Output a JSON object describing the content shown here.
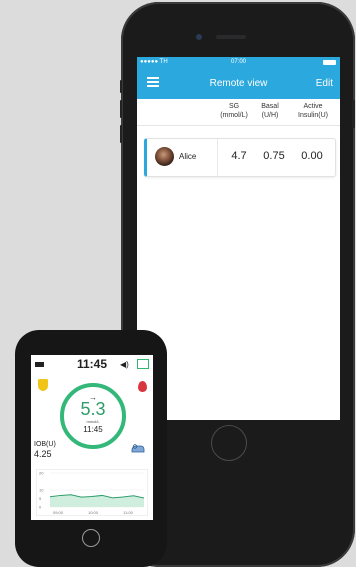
{
  "phone": {
    "status_bar": {
      "carrier": "●●●●● TH",
      "time": "07:00"
    },
    "nav": {
      "title": "Remote view",
      "edit_label": "Edit"
    },
    "columns": {
      "sg": {
        "name": "SG",
        "unit": "(mmol/L)"
      },
      "basal": {
        "name": "Basal",
        "unit": "(U/H)"
      },
      "active": {
        "name": "Active",
        "unit": "Insulin(U)"
      }
    },
    "patients": [
      {
        "name": "Alice",
        "sg": "4.7",
        "basal": "0.75",
        "active_insulin": "0.00"
      }
    ]
  },
  "controller": {
    "time": "11:45",
    "glucose": "5.3",
    "trend_arrow": "→",
    "unit": "mmol/L",
    "reading_time": "11:45",
    "iob_label": "IOB(U)",
    "iob_value": "4.25"
  },
  "chart_data": {
    "type": "area",
    "x_ticks": [
      "09:00",
      "10:00",
      "11:00"
    ],
    "y_ticks": [
      "20",
      "10",
      "5",
      "0"
    ],
    "ylim": [
      0,
      20
    ],
    "series": [
      {
        "values": [
          6.0,
          6.8,
          7.2,
          5.8,
          6.2,
          6.8,
          5.4,
          5.9,
          6.6,
          5.3
        ]
      }
    ],
    "colors": {
      "line": "#2f9d6a",
      "fill": "#cfeede"
    }
  },
  "colors": {
    "accent": "#2ba8dd",
    "ring": "#33b87a",
    "glucose": "#2f9d6a"
  },
  "icons": [
    "menu-icon",
    "battery-icon",
    "speaker-icon",
    "shield-icon",
    "blood-drop-icon",
    "sensor-icon"
  ]
}
